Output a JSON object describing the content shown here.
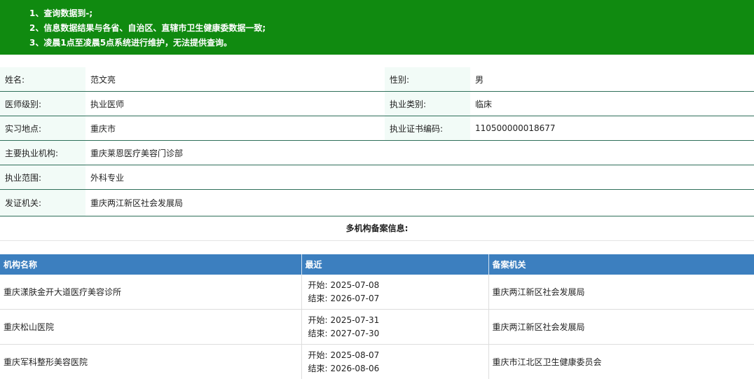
{
  "notice": {
    "lines": [
      "1、查询数据到-;",
      "2、信息数据结果与各省、自治区、直辖市卫生健康委数据一致;",
      "3、凌晨1点至凌晨5点系统进行维护，无法提供查询。"
    ]
  },
  "doctor": {
    "name_label": "姓名:",
    "name": "范文亮",
    "gender_label": "性别:",
    "gender": "男",
    "level_label": "医师级别:",
    "level": "执业医师",
    "category_label": "执业类别:",
    "category": "临床",
    "practice_place_label": "实习地点:",
    "practice_place": "重庆市",
    "cert_no_label": "执业证书编码:",
    "cert_no": "110500000018677",
    "main_org_label": "主要执业机构:",
    "main_org": "重庆莱恩医疗美容门诊部",
    "scope_label": "执业范围:",
    "scope": "外科专业",
    "issuer_label": "发证机关:",
    "issuer": "重庆两江新区社会发展局"
  },
  "multi_org": {
    "title": "多机构备案信息:",
    "headers": [
      "机构名称",
      "最近",
      "备案机关"
    ],
    "start_label": "开始:",
    "end_label": "结束:",
    "rows": [
      {
        "org": "重庆漾肤金开大道医疗美容诊所",
        "start": "2025-07-08",
        "end": "2026-07-07",
        "authority": "重庆两江新区社会发展局"
      },
      {
        "org": "重庆松山医院",
        "start": "2025-07-31",
        "end": "2027-07-30",
        "authority": "重庆两江新区社会发展局"
      },
      {
        "org": "重庆军科整形美容医院",
        "start": "2025-08-07",
        "end": "2026-08-06",
        "authority": "重庆市江北区卫生健康委员会"
      }
    ]
  }
}
